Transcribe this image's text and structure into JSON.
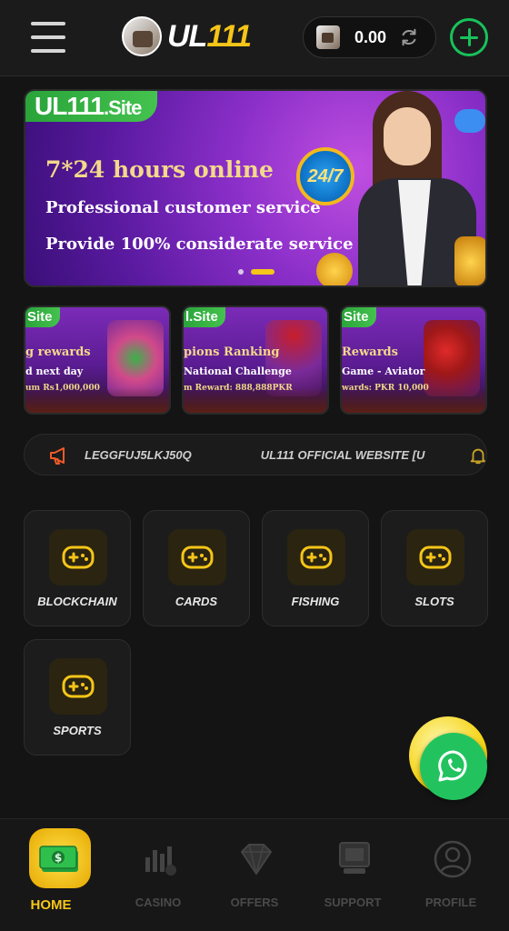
{
  "header": {
    "logo_prefix": "UL",
    "logo_suffix": "111",
    "balance": "0.00"
  },
  "hero": {
    "site_label_main": "UL111",
    "site_label_ext": ".Site",
    "title": "7*24 hours online",
    "line1": "Professional customer service",
    "line2": "Provide 100% considerate service",
    "badge": "24/7"
  },
  "promos": [
    {
      "site": "Site",
      "t1": "g rewards",
      "t2": "d next day",
      "t3": "um Rs1,000,000"
    },
    {
      "site": "l.Site",
      "t1": "pions Ranking",
      "t2": "National Challenge",
      "t3": "m Reward: 888,888PKR"
    },
    {
      "site": "Site",
      "t1": "Rewards",
      "t2": "Game - Aviator",
      "t3": "wards: PKR 10,000"
    }
  ],
  "notice": {
    "text_left": "LEGGFUJ5LKJ50Q",
    "text_right": "UL111 OFFICIAL WEBSITE  [U"
  },
  "categories": [
    {
      "label": "BLOCKCHAIN"
    },
    {
      "label": "CARDS"
    },
    {
      "label": "FISHING"
    },
    {
      "label": "SLOTS"
    },
    {
      "label": "SPORTS"
    }
  ],
  "nav": {
    "home": "HOME",
    "casino": "CASINO",
    "offers": "OFFERS",
    "support": "SUPPORT",
    "profile": "PROFILE"
  },
  "colors": {
    "accent": "#f5c518",
    "add": "#18c25a",
    "whatsapp": "#22c35e"
  },
  "icons": {
    "menu": "hamburger-icon",
    "refresh": "refresh-icon",
    "add": "plus-icon",
    "notice": "megaphone-icon",
    "bell": "bell-icon",
    "category": "gamepad-icon",
    "whatsapp": "whatsapp-icon"
  }
}
